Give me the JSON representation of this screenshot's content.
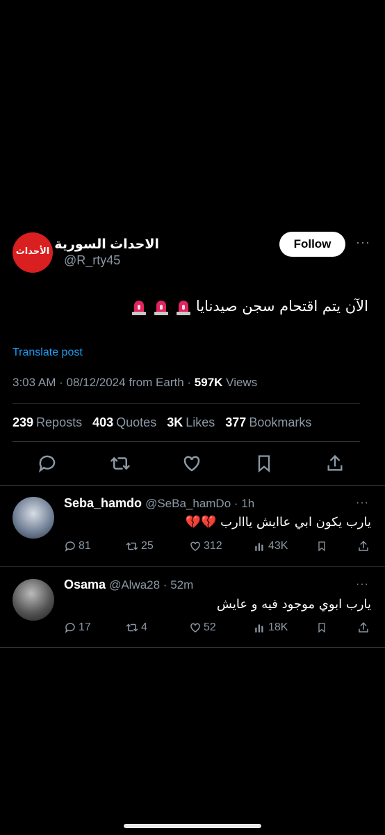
{
  "tweet": {
    "author_name": "الاحداث السورية",
    "author_handle": "@R_rty45",
    "avatar_text": "الأحداث",
    "follow_label": "Follow",
    "more": "···",
    "text": "الآن يتم اقتحام سجن صيدنايا",
    "translate_label": "Translate post",
    "time": "3:03 AM",
    "date": "08/12/2024",
    "location": "from Earth",
    "views_count": "597K",
    "views_label": "Views",
    "reposts_count": "239",
    "reposts_label": "Reposts",
    "quotes_count": "403",
    "quotes_label": "Quotes",
    "likes_count": "3K",
    "likes_label": "Likes",
    "bookmarks_count": "377",
    "bookmarks_label": "Bookmarks"
  },
  "replies": [
    {
      "name": "Seba_hamdo",
      "handle": "@SeBa_hamDo",
      "time": "1h",
      "text": "يارب يكون ابي عاايش يااارب 💔💔",
      "replies": "81",
      "reposts": "25",
      "likes": "312",
      "views": "43K"
    },
    {
      "name": "Osama",
      "handle": "@Alwa28",
      "time": "52m",
      "text": "يارب ابوي موجود فيه و عايش",
      "replies": "17",
      "reposts": "4",
      "likes": "52",
      "views": "18K"
    }
  ],
  "colors": {
    "background": "#000000",
    "text": "#e7e9ea",
    "secondary": "#8b98a5",
    "link": "#1d9bf0",
    "divider": "#2f3336",
    "avatar_red": "#d91f1f"
  },
  "icons": [
    "reply-icon",
    "repost-icon",
    "like-icon",
    "bookmark-icon",
    "share-icon",
    "views-icon",
    "siren-icon"
  ]
}
